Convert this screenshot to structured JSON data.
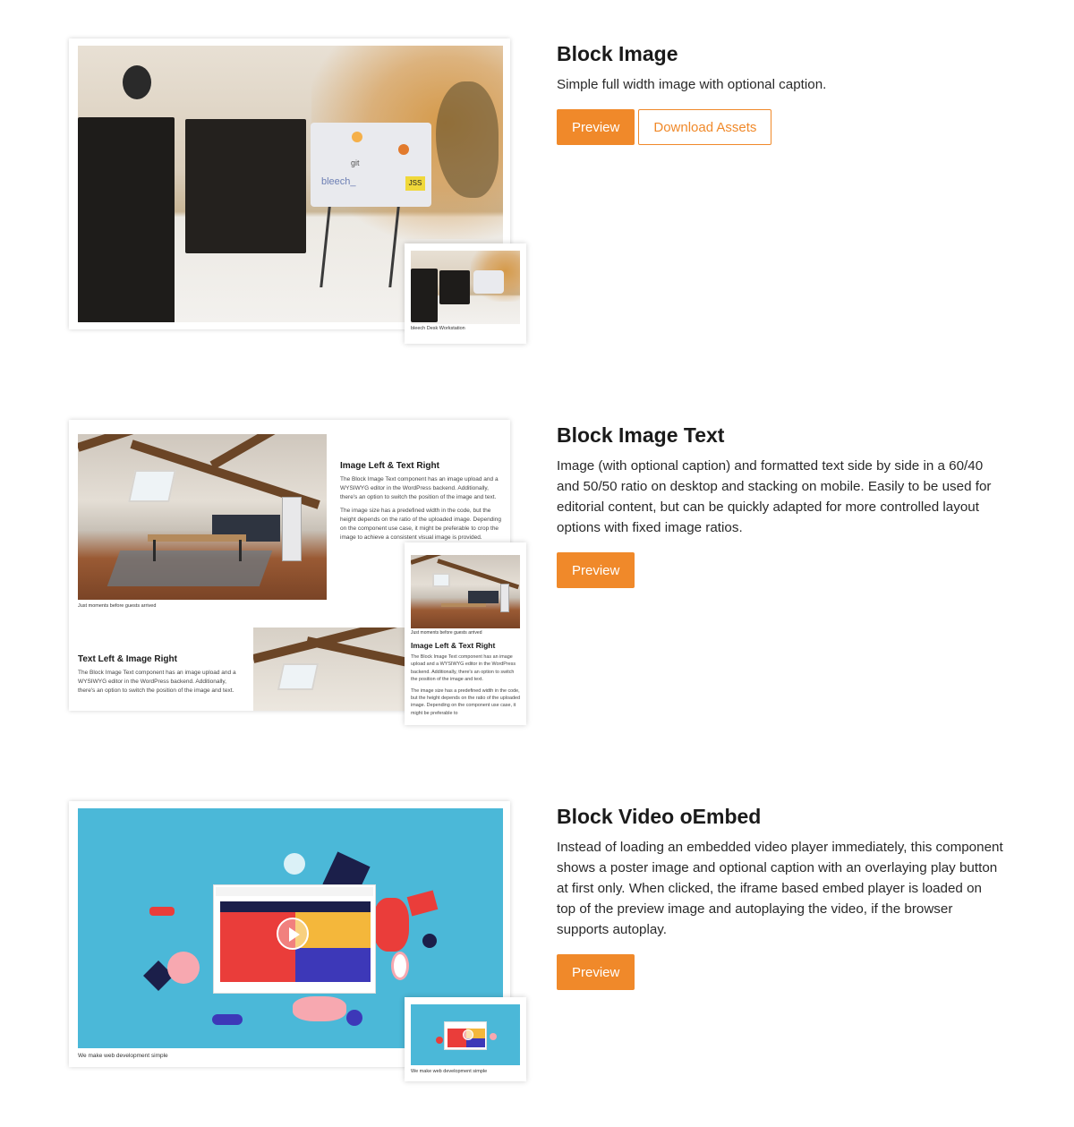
{
  "blocks": [
    {
      "title": "Block Image",
      "description": "Simple full width image with optional caption.",
      "preview_label": "Preview",
      "download_label": "Download Assets",
      "mobile_caption": "bleech Desk Workstation"
    },
    {
      "title": "Block Image Text",
      "description": "Image (with optional caption) and formatted text side by side in a 60/40 and 50/50 ratio on desktop and stacking on mobile. Easily to be used for editorial content, but can be quickly adapted for more controlled layout options with fixed image ratios.",
      "preview_label": "Preview",
      "desktop": {
        "heading_1": "Image Left & Text Right",
        "para_1": "The Block Image Text component has an image upload and a WYSIWYG editor in the WordPress backend. Additionally, there's an option to switch the position of the image and text.",
        "para_2": "The image size has a predefined width in the code, but the height depends on the ratio of the uploaded image. Depending on the component use case, it might be preferable to crop the image to achieve a consistent visual image is provided.",
        "caption_1": "Just moments before guests arrived",
        "heading_2": "Text Left & Image Right",
        "para_3": "The Block Image Text component has an image upload and a WYSIWYG editor in the WordPress backend. Additionally, there's an option to switch the position of the image and text."
      },
      "mobile": {
        "caption": "Just moments before guests arrived",
        "heading": "Image Left & Text Right",
        "para_1": "The Block Image Text component has an image upload and a WYSIWYG editor in the WordPress backend. Additionally, there's an option to switch the position of the image and text.",
        "para_2": "The image size has a predefined width in the code, but the height depends on the ratio of the uploaded image. Depending on the component use case, it might be preferable to"
      }
    },
    {
      "title": "Block Video oEmbed",
      "description": "Instead of loading an embedded video player immediately, this component shows a poster image and optional caption with an overlaying play button at first only. When clicked, the iframe based embed player is loaded on top of the preview image and autoplaying the video, if the browser supports autoplay.",
      "preview_label": "Preview",
      "desktop_caption": "We make web development simple",
      "mobile_caption": "We make web development simple"
    }
  ],
  "colors": {
    "accent": "#f0892a",
    "poster_bg": "#4bb8d8"
  }
}
